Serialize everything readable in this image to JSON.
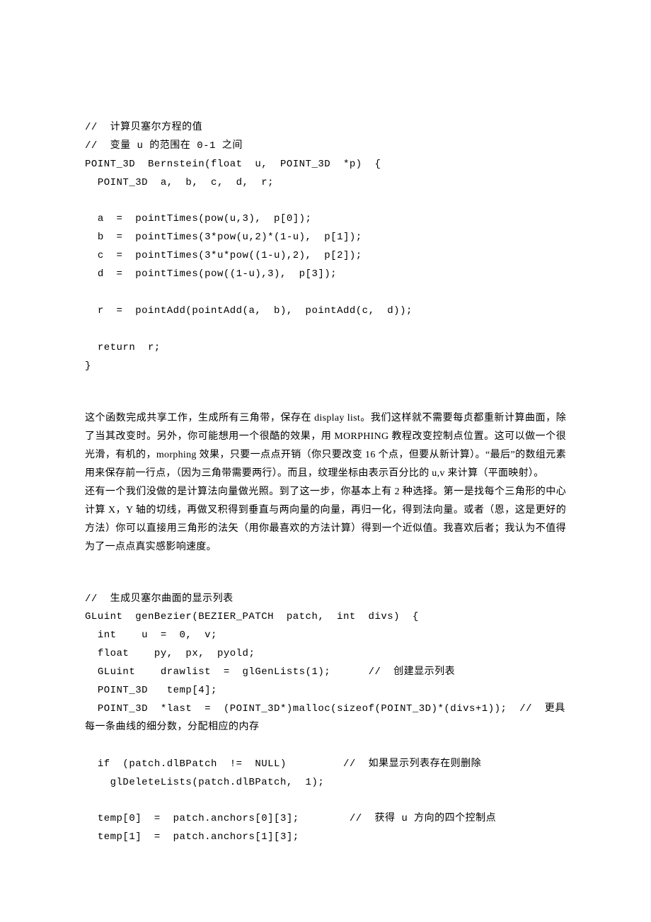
{
  "code1": "//  计算贝塞尔方程的值\n//  变量 u 的范围在 0-1 之间\nPOINT_3D  Bernstein(float  u,  POINT_3D  *p)  {\n  POINT_3D  a,  b,  c,  d,  r;\n\n  a  =  pointTimes(pow(u,3),  p[0]);\n  b  =  pointTimes(3*pow(u,2)*(1-u),  p[1]);\n  c  =  pointTimes(3*u*pow((1-u),2),  p[2]);\n  d  =  pointTimes(pow((1-u),3),  p[3]);\n\n  r  =  pointAdd(pointAdd(a,  b),  pointAdd(c,  d));\n\n  return  r;\n}",
  "para1": "  这个函数完成共享工作，生成所有三角带，保存在 display  list。我们这样就不需要每贞都重新计算曲面，除了当其改变时。另外，你可能想用一个很酷的效果，用 MORPHING 教程改变控制点位置。这可以做一个很光滑，有机的，morphing 效果，只要一点点开销（你只要改变 16 个点，但要从新计算）。“最后”的数组元素用来保存前一行点，（因为三角带需要两行）。而且，纹理坐标由表示百分比的 u,v 来计算（平面映射）。",
  "para2": "还有一个我们没做的是计算法向量做光照。到了这一步，你基本上有 2 种选择。第一是找每个三角形的中心计算 X，Y 轴的切线，再做叉积得到垂直与两向量的向量，再归一化，得到法向量。或者（恩，这是更好的方法）你可以直接用三角形的法矢（用你最喜欢的方法计算）得到一个近似值。我喜欢后者；我认为不值得为了一点点真实感影响速度。",
  "code2": "//  生成贝塞尔曲面的显示列表\nGLuint  genBezier(BEZIER_PATCH  patch,  int  divs)  {\n  int    u  =  0,  v;\n  float    py,  px,  pyold;\n  GLuint    drawlist  =  glGenLists(1);      //  创建显示列表\n  POINT_3D   temp[4];\n  POINT_3D  *last  =  (POINT_3D*)malloc(sizeof(POINT_3D)*(divs+1));  //  更具每一条曲线的细分数，分配相应的内存\n\n  if  (patch.dlBPatch  !=  NULL)         //  如果显示列表存在则删除\n    glDeleteLists(patch.dlBPatch,  1);\n\n  temp[0]  =  patch.anchors[0][3];        //  获得 u 方向的四个控制点\n  temp[1]  =  patch.anchors[1][3];"
}
